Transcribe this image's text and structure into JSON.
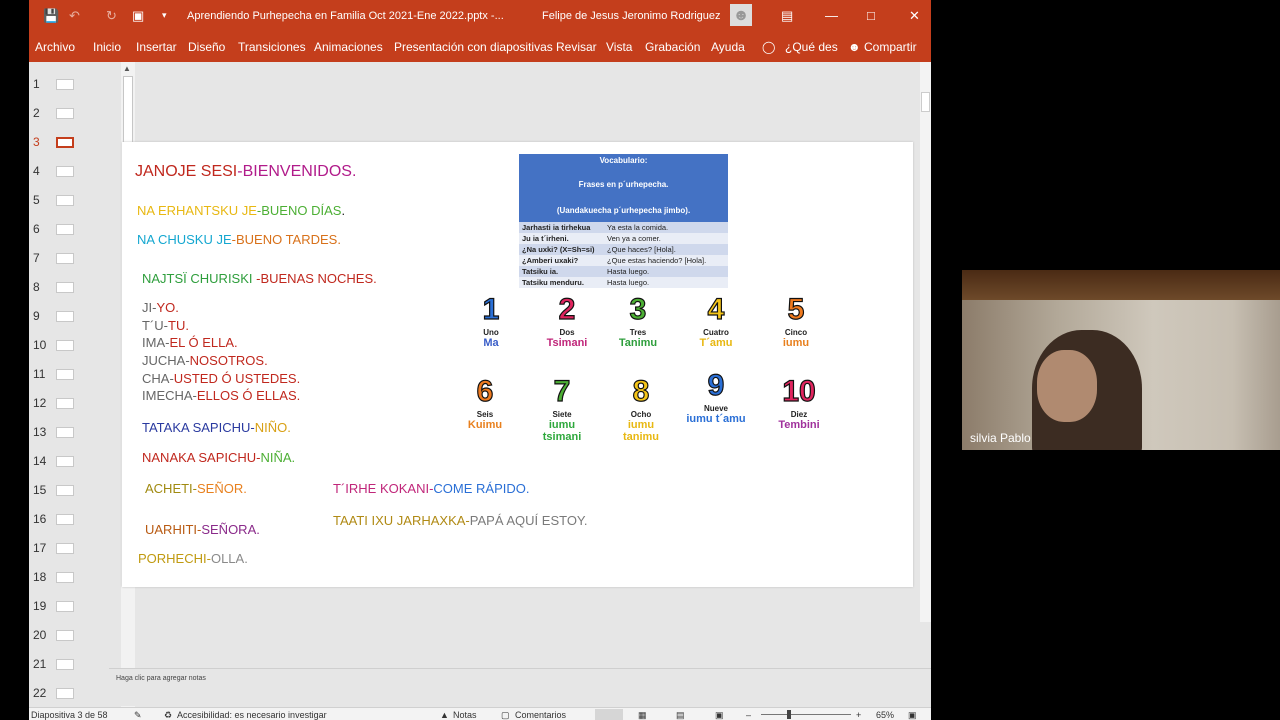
{
  "titlebar": {
    "doc_title": "Aprendiendo Purhepecha en Familia Oct 2021-Ene 2022.pptx  -...",
    "user": "Felipe de Jesus Jeronimo Rodriguez"
  },
  "ribbon": {
    "tabs": [
      "Archivo",
      "Inicio",
      "Insertar",
      "Diseño",
      "Transiciones",
      "Animaciones",
      "Presentación con diapositivas",
      "Revisar",
      "Vista",
      "Grabación",
      "Ayuda"
    ],
    "search": "¿Qué des",
    "share": "Compartir"
  },
  "thumbnails": [
    "1",
    "2",
    "3",
    "4",
    "5",
    "6",
    "7",
    "8",
    "9",
    "10",
    "11",
    "12",
    "13",
    "14",
    "15",
    "16",
    "17",
    "18",
    "19",
    "20",
    "21",
    "22"
  ],
  "active_slide": "3",
  "slide": {
    "title": {
      "a": "JANOJE SESI",
      "b": "-",
      "c": "BIENVENIDOS."
    },
    "greetings": [
      {
        "a": "NA ERHANTSKU JE",
        "b": "-BUENO DÍAS",
        "c": "."
      },
      {
        "a": "NA CHUSKU JE",
        "b": "-BUENO TARDES."
      },
      {
        "a": "NAJTSÏ CHURISKI",
        "b": " -BUENAS NOCHES."
      }
    ],
    "pronouns": [
      {
        "a": "JI-",
        "b": "YO."
      },
      {
        "a": "T´U-",
        "b": "TU."
      },
      {
        "a": "IMA-",
        "b": "EL Ó ELLA."
      },
      {
        "a": "JUCHA-",
        "b": "NOSOTROS."
      },
      {
        "a": "CHA-",
        "b": "USTED Ó USTEDES."
      },
      {
        "a": "IMECHA-",
        "b": "ELLOS Ó ELLAS."
      }
    ],
    "family": [
      {
        "a": "TATAKA SAPICHU-",
        "b": "NIÑO."
      },
      {
        "a": "NANAKA SAPICHU-",
        "b": "NIÑA."
      },
      {
        "a": "ACHETI-",
        "b": "SEÑOR."
      },
      {
        "a": "UARHITI-",
        "b": "SEÑORA."
      },
      {
        "a": "PORHECHI-",
        "b": "OLLA."
      }
    ],
    "phrases": [
      {
        "a": "T´IRHE KOKANI-",
        "b": "COME RÁPIDO."
      },
      {
        "a": "TAATI IXU JARHAXKA-",
        "b": "PAPÁ AQUÍ ESTOY."
      }
    ],
    "vocab": {
      "line1": "Vocabulario:",
      "line2": "Frases en p´urhepecha.",
      "line3": "(Uandakuecha p´urhepecha jimbo).",
      "rows": [
        [
          "Jarhasti ia tirhekua",
          "Ya esta la comida."
        ],
        [
          "Ju ia t´irheni.",
          "Ven ya a comer."
        ],
        [
          "¿Na uxki? (X=Sh=si)",
          "¿Que haces? [Hola]."
        ],
        [
          "¿Amberi uxaki?",
          "¿Que estas haciendo? [Hola]."
        ],
        [
          "Tatsiku ia.",
          "Hasta luego."
        ],
        [
          "Tatsiku menduru.",
          "Hasta luego."
        ]
      ]
    },
    "numbers": [
      {
        "n": "1",
        "es": "Uno",
        "p": "Ma",
        "c": "#2a6fd6",
        "pc": "#3a5ec8"
      },
      {
        "n": "2",
        "es": "Dos",
        "p": "Tsimani",
        "c": "#e0245e",
        "pc": "#c0267a"
      },
      {
        "n": "3",
        "es": "Tres",
        "p": "Tanimu",
        "c": "#4caf34",
        "pc": "#2e9e3c"
      },
      {
        "n": "4",
        "es": "Cuatro",
        "p": "T´amu",
        "c": "#f5c518",
        "pc": "#e8b812"
      },
      {
        "n": "5",
        "es": "Cinco",
        "p": "iumu",
        "c": "#f07a1e",
        "pc": "#e8801e"
      },
      {
        "n": "6",
        "es": "Seis",
        "p": "Kuimu",
        "c": "#f07a1e",
        "pc": "#e8801e"
      },
      {
        "n": "7",
        "es": "Siete",
        "p": "iumu tsimani",
        "c": "#4caf34",
        "pc": "#2ea83c"
      },
      {
        "n": "8",
        "es": "Ocho",
        "p": "iumu tanimu",
        "c": "#f5c518",
        "pc": "#e8b812"
      },
      {
        "n": "9",
        "es": "Nueve",
        "p": "iumu t´amu",
        "c": "#2a6fd6",
        "pc": "#2a6fd6"
      },
      {
        "n": "10",
        "es": "Diez",
        "p": "Tembini",
        "c": "#e0245e",
        "pc": "#a0309c"
      }
    ]
  },
  "notes_placeholder": "Haga clic para agregar notas",
  "status": {
    "slide_of": "Diapositiva 3 de 58",
    "accessibility": "Accesibilidad: es necesario investigar",
    "notes": "Notas",
    "comments": "Comentarios",
    "zoom": "65%"
  },
  "webcam": {
    "name": "silvia Pablo"
  }
}
